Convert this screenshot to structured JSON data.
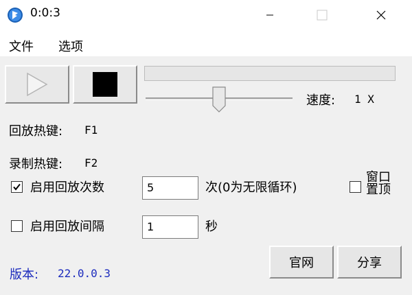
{
  "window": {
    "title": "0:0:3",
    "accent": "#1a5fb4"
  },
  "menu": {
    "file": "文件",
    "options": "选项"
  },
  "controls": {
    "speed_label": "速度:",
    "speed_value": "1 X",
    "slider_position": 0.5
  },
  "hotkeys": {
    "playback_label": "回放热键:",
    "playback_key": "F1",
    "record_label": "录制热键:",
    "record_key": "F2"
  },
  "options": {
    "repeat_count": {
      "label": "启用回放次数",
      "checked": true,
      "value": "5",
      "unit": "次(0为无限循环)"
    },
    "interval": {
      "label": "启用回放间隔",
      "checked": false,
      "value": "1",
      "unit": "秒"
    },
    "always_on_top": {
      "label": "窗口置顶",
      "checked": false
    }
  },
  "footer": {
    "version_label": "版本:",
    "version": "22.0.0.3",
    "version_color": "#1c2bbd",
    "official_button": "官网",
    "share_button": "分享"
  }
}
